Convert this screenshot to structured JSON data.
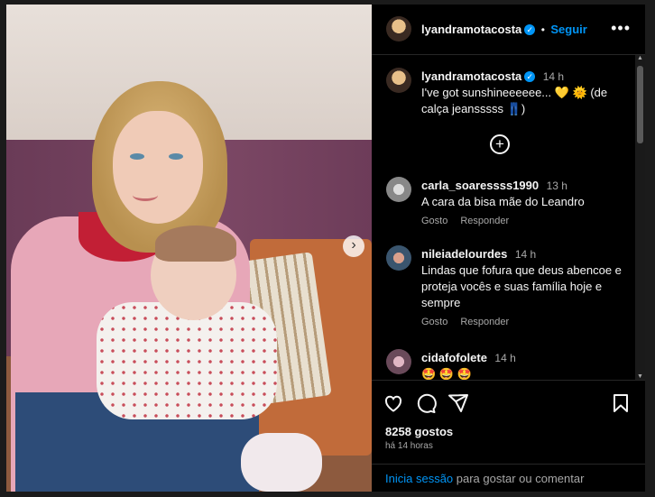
{
  "post": {
    "username": "lyandramotacosta",
    "follow_label": "Seguir",
    "more_icon": "more-horizontal-icon",
    "caption_time": "14 h",
    "caption": "I've got sunshineeeeee... 💛 🌞 (de calça jeansssss 👖)"
  },
  "add_icon": "plus-circle-icon",
  "comments": [
    {
      "user": "carla_soaressss1990",
      "time": "13 h",
      "text": "A cara da bisa mãe do Leandro",
      "like": "Gosto",
      "reply": "Responder"
    },
    {
      "user": "nileiadelourdes",
      "time": "14 h",
      "text": "Lindas que fofura que deus abencoe e proteja vocês e suas família hoje e sempre",
      "like": "Gosto",
      "reply": "Responder"
    },
    {
      "user": "cidafofolete",
      "time": "14 h",
      "text": "🤩 🤩 🤩"
    }
  ],
  "actions": {
    "likes": "8258 gostos",
    "ago": "há 14 horas",
    "login_link": "Inicia sessão",
    "login_rest": " para gostar ou comentar"
  },
  "colors": {
    "accent": "#0095f6",
    "background": "#000000",
    "muted": "#a8a8a8"
  }
}
